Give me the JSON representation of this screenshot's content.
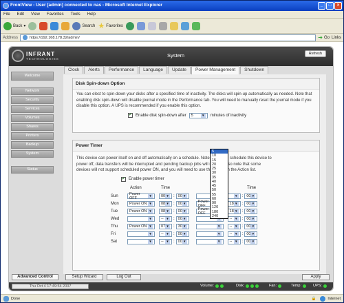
{
  "window": {
    "title": "FrontView - User [admin] connected to nas - Microsoft Internet Explorer"
  },
  "menu": [
    "File",
    "Edit",
    "View",
    "Favorites",
    "Tools",
    "Help"
  ],
  "toolbar": {
    "back": "Back",
    "search": "Search",
    "favorites": "Favorites"
  },
  "address": {
    "label": "Address",
    "url": "https://192.168.178.32/admin/",
    "go": "Go",
    "links": "Links"
  },
  "app": {
    "logo_main": "INFRANT",
    "logo_sub": "TECHNOLOGIES",
    "page_title": "System",
    "refresh": "Refresh"
  },
  "tabs": [
    "Clock",
    "Alerts",
    "Performance",
    "Language",
    "Update",
    "Power Management",
    "Shutdown"
  ],
  "sidebar": [
    "Welcome",
    "Network",
    "Security",
    "Services",
    "Volumes",
    "Shares",
    "Printers",
    "Backup",
    "System",
    "Status"
  ],
  "spindown": {
    "title": "Disk Spin-down Option",
    "text": "You can elect to spin-down your disks after a specified time of inactivity. The disks will spin-up automatically as needed. Note that enabling disk spin-down will disable journal mode in the Performance tab. You will need to manually reset the journal mode if you disable this option. A UPS is recommended if you enable this option.",
    "checkbox_label": "Enable disk spin-down after",
    "value": "5",
    "suffix": "minutes of inactivity",
    "options": [
      "5",
      "10",
      "15",
      "20",
      "25",
      "30",
      "35",
      "40",
      "45",
      "50",
      "55",
      "60",
      "90",
      "120",
      "180",
      "240"
    ]
  },
  "power": {
    "title": "Power Timer",
    "text1": "This device can power itself on and off automatically on a schedule. Note that if you schedule this device to",
    "text2": "power off, data transfers will be interrupted and pending backup jobs will not run. Also note that some",
    "text3": "devices will not support scheduled power ON, and you will need to use this option in the Action list.",
    "checkbox_label": "Enable power timer",
    "col_action": "Action",
    "col_time": "Time",
    "rows": [
      {
        "day": "Sun",
        "a1": "Power OFF",
        "h1": "00",
        "m1": "00",
        "a2": "",
        "h2": "",
        "m2": "00"
      },
      {
        "day": "Mon",
        "a1": "Power ON",
        "h1": "08",
        "m1": "00",
        "a2": "Power OFF",
        "h2": "18",
        "m2": "00"
      },
      {
        "day": "Tue",
        "a1": "Power ON",
        "h1": "08",
        "m1": "00",
        "a2": "Power OFF",
        "h2": "18",
        "m2": "00"
      },
      {
        "day": "Wed",
        "a1": "",
        "h1": "--",
        "m1": "00",
        "a2": "",
        "h2": "--",
        "m2": "00"
      },
      {
        "day": "Thu",
        "a1": "Power ON",
        "h1": "07",
        "m1": "30",
        "a2": "",
        "h2": "--",
        "m2": "00"
      },
      {
        "day": "Fri",
        "a1": "",
        "h1": "--",
        "m1": "00",
        "a2": "",
        "h2": "--",
        "m2": "00"
      },
      {
        "day": "Sat",
        "a1": "",
        "h1": "--",
        "m1": "00",
        "a2": "",
        "h2": "--",
        "m2": "00"
      }
    ]
  },
  "bottom": {
    "advanced": "Advanced Control",
    "wizard": "Setup Wizard",
    "logout": "Log Out",
    "apply": "Apply",
    "date": "Thu Oct 4 17:49:54 2007",
    "volume": "Volume:",
    "disk": "Disk:",
    "fan": "Fan:",
    "temp": "Temp:",
    "ups": "UPS:"
  },
  "iestatus": {
    "left": "Done",
    "right": "Internet"
  },
  "colors": {
    "accent": "#2a6ae8",
    "status_green": "#3ad23a"
  }
}
